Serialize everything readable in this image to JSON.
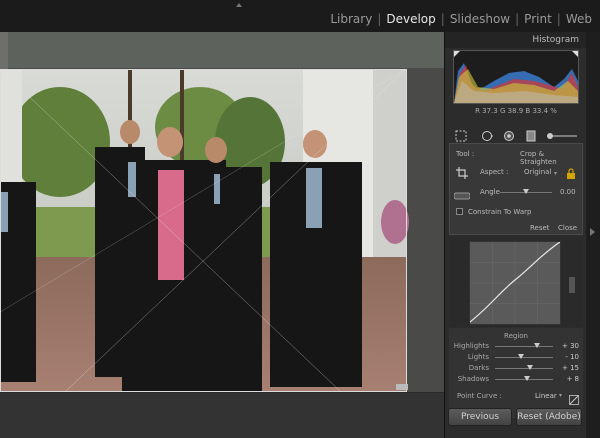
{
  "modules": [
    {
      "label": "Library",
      "active": false
    },
    {
      "label": "Develop",
      "active": true
    },
    {
      "label": "Slideshow",
      "active": false
    },
    {
      "label": "Print",
      "active": false
    },
    {
      "label": "Web",
      "active": false
    }
  ],
  "histogram": {
    "title": "Histogram",
    "readout": "R 37.3  G 38.9  B 33.4 %"
  },
  "crop": {
    "tool_label": "Tool :",
    "tool_name": "Crop & Straighten",
    "aspect_label": "Aspect :",
    "aspect_value": "Original",
    "angle_label": "Angle",
    "angle_value": "0.00",
    "constrain_label": "Constrain To Warp",
    "reset_label": "Reset",
    "close_label": "Close"
  },
  "region": {
    "title": "Region",
    "sliders": [
      {
        "label": "Highlights",
        "value": "+ 30",
        "position": 0.72
      },
      {
        "label": "Lights",
        "value": "- 10",
        "position": 0.44
      },
      {
        "label": "Darks",
        "value": "+ 15",
        "position": 0.6
      },
      {
        "label": "Shadows",
        "value": "+ 8",
        "position": 0.56
      }
    ],
    "point_curve_label": "Point Curve :",
    "point_curve_value": "Linear"
  },
  "buttons": {
    "previous": "Previous",
    "reset_adobe": "Reset (Adobe)"
  },
  "colors": {
    "accent": "#e8e8e8",
    "panel": "#2c2c2c"
  }
}
